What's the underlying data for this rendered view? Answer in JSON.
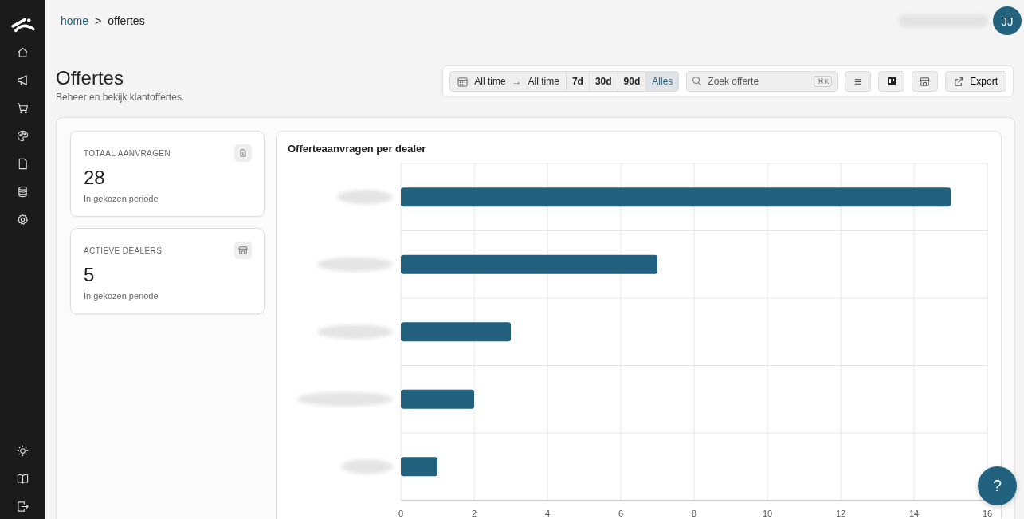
{
  "breadcrumb": [
    {
      "label": "home",
      "kind": "link"
    },
    {
      "label": ">",
      "kind": "separator"
    },
    {
      "label": "offertes",
      "kind": "current"
    }
  ],
  "user": {
    "initials": "JJ"
  },
  "page": {
    "title": "Offertes",
    "subtitle": "Beheer en bekijk klantoffertes."
  },
  "toolbar": {
    "date_from": "All time",
    "date_arrow": "→",
    "date_to": "All time",
    "ranges": [
      {
        "label": "7d",
        "selected": false
      },
      {
        "label": "30d",
        "selected": false
      },
      {
        "label": "90d",
        "selected": false
      },
      {
        "label": "Alles",
        "selected": true
      }
    ],
    "search": {
      "placeholder": "Zoek offerte",
      "shortcut": "⌘K"
    },
    "export": "Export"
  },
  "stats": [
    {
      "label": "TOTAAL AANVRAGEN",
      "value": "28",
      "caption": "In gekozen periode",
      "kind": "document"
    },
    {
      "label": "ACTIEVE DEALERS",
      "value": "5",
      "caption": "In gekozen periode",
      "kind": "store"
    }
  ],
  "chart": {
    "title": "Offerteaanvragen per dealer",
    "chart_data": {
      "type": "bar",
      "orientation": "horizontal",
      "series": [
        {
          "color": "#22627f",
          "values": [
            15,
            7,
            3,
            2,
            1
          ]
        }
      ],
      "xlim": [
        0,
        16
      ],
      "grid": true,
      "xticks": [
        0,
        2,
        4,
        6,
        8,
        10,
        12,
        14,
        16
      ]
    }
  },
  "help": "?"
}
